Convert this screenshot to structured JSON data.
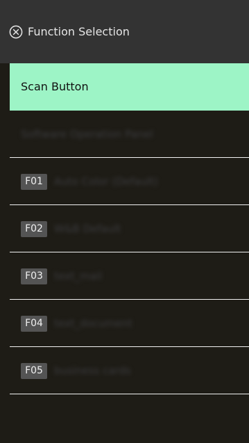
{
  "header": {
    "title": "Function Selection",
    "close_icon": "circle-x-icon"
  },
  "list": {
    "selected": {
      "label": "Scan Button"
    },
    "operation_panel": {
      "label": "Software Operation Panel"
    },
    "functions": [
      {
        "key": "F01",
        "label": "Auto Color (Default)"
      },
      {
        "key": "F02",
        "label": "W&B Default"
      },
      {
        "key": "F03",
        "label": "text_mail"
      },
      {
        "key": "F04",
        "label": "text_document"
      },
      {
        "key": "F05",
        "label": "business cards"
      }
    ]
  },
  "colors": {
    "header_bg": "#333333",
    "list_bg": "#1e1c16",
    "selected_bg": "#9df4c6",
    "divider": "#f2f2f2",
    "fkey_bg": "#545454"
  }
}
